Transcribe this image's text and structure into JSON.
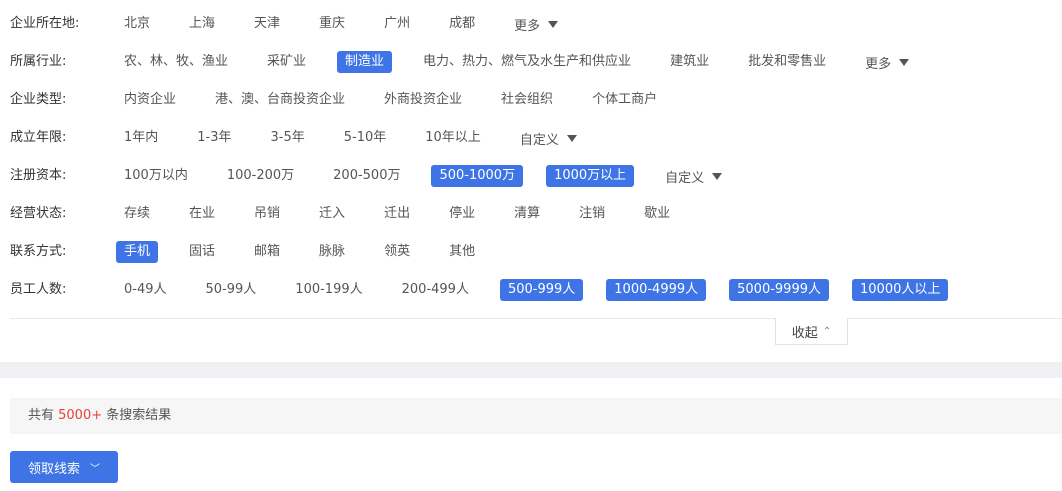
{
  "filters": [
    {
      "label": "企业所在地:",
      "options": [
        {
          "t": "北京"
        },
        {
          "t": "上海"
        },
        {
          "t": "天津"
        },
        {
          "t": "重庆"
        },
        {
          "t": "广州"
        },
        {
          "t": "成都"
        }
      ],
      "more": "更多"
    },
    {
      "label": "所属行业:",
      "options": [
        {
          "t": "农、林、牧、渔业"
        },
        {
          "t": "采矿业"
        },
        {
          "t": "制造业",
          "sel": true
        },
        {
          "t": "电力、热力、燃气及水生产和供应业"
        },
        {
          "t": "建筑业"
        },
        {
          "t": "批发和零售业"
        }
      ],
      "more": "更多"
    },
    {
      "label": "企业类型:",
      "options": [
        {
          "t": "内资企业"
        },
        {
          "t": "港、澳、台商投资企业"
        },
        {
          "t": "外商投资企业"
        },
        {
          "t": "社会组织"
        },
        {
          "t": "个体工商户"
        }
      ]
    },
    {
      "label": "成立年限:",
      "options": [
        {
          "t": "1年内"
        },
        {
          "t": "1-3年"
        },
        {
          "t": "3-5年"
        },
        {
          "t": "5-10年"
        },
        {
          "t": "10年以上"
        }
      ],
      "more": "自定义"
    },
    {
      "label": "注册资本:",
      "options": [
        {
          "t": "100万以内"
        },
        {
          "t": "100-200万"
        },
        {
          "t": "200-500万"
        },
        {
          "t": "500-1000万",
          "sel": true
        },
        {
          "t": "1000万以上",
          "sel": true
        }
      ],
      "more": "自定义"
    },
    {
      "label": "经营状态:",
      "options": [
        {
          "t": "存续"
        },
        {
          "t": "在业"
        },
        {
          "t": "吊销"
        },
        {
          "t": "迁入"
        },
        {
          "t": "迁出"
        },
        {
          "t": "停业"
        },
        {
          "t": "清算"
        },
        {
          "t": "注销"
        },
        {
          "t": "歇业"
        }
      ]
    },
    {
      "label": "联系方式:",
      "options": [
        {
          "t": "手机",
          "sel": true
        },
        {
          "t": "固话"
        },
        {
          "t": "邮箱"
        },
        {
          "t": "脉脉"
        },
        {
          "t": "领英"
        },
        {
          "t": "其他"
        }
      ]
    },
    {
      "label": "员工人数:",
      "options": [
        {
          "t": "0-49人"
        },
        {
          "t": "50-99人"
        },
        {
          "t": "100-199人"
        },
        {
          "t": "200-499人"
        },
        {
          "t": "500-999人",
          "sel": true
        },
        {
          "t": "1000-4999人",
          "sel": true
        },
        {
          "t": "5000-9999人",
          "sel": true
        },
        {
          "t": "10000人以上",
          "sel": true
        }
      ]
    }
  ],
  "collapse_label": "收起",
  "result": {
    "prefix": "共有 ",
    "count": "5000+",
    "suffix": " 条搜索结果"
  },
  "get_leads_label": "领取线索",
  "colors": {
    "accent": "#3e74e6",
    "count": "#e8423a"
  }
}
